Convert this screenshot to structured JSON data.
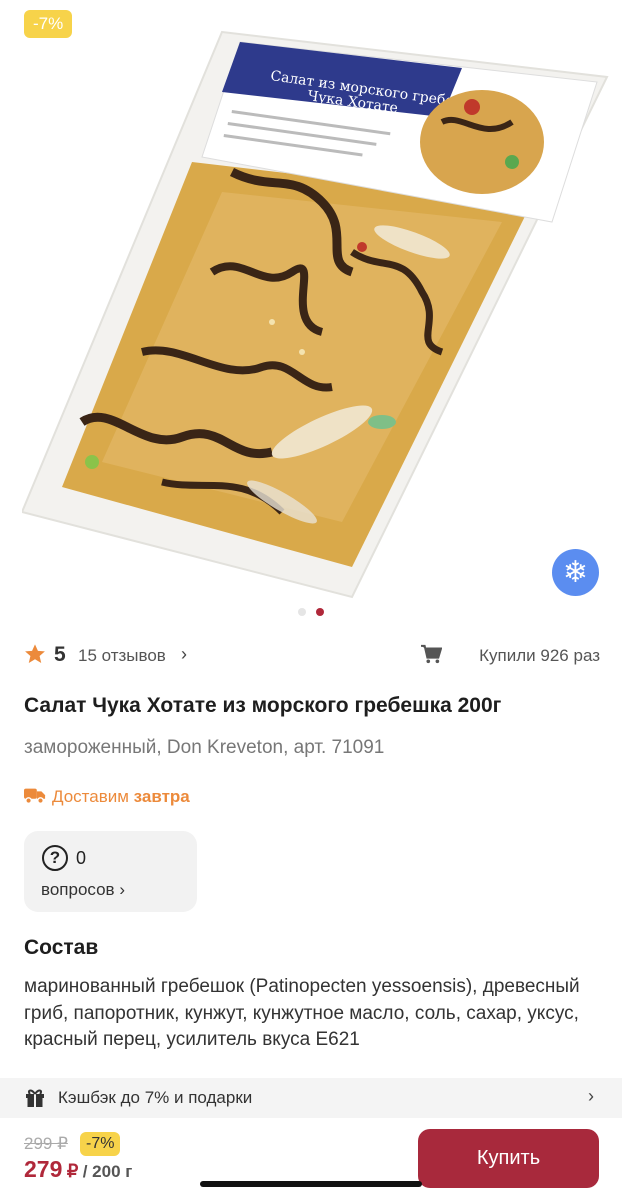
{
  "gallery": {
    "discount_badge": "-7%",
    "package_title_line1": "Салат из морского гребешка",
    "package_title_line2": "Чука Хотате",
    "slide_index": 2,
    "slide_count": 2
  },
  "rating": {
    "value": "5",
    "reviews": "15 отзывов",
    "bought": "Купили 926 раз"
  },
  "product": {
    "title": "Салат Чука Хотате из морского гребешка 200г",
    "subtitle": "замороженный, Don Kreveton, арт. 71091"
  },
  "delivery": {
    "prefix": "Доставим",
    "day": "завтра"
  },
  "questions": {
    "count": "0",
    "label": "вопросов"
  },
  "composition": {
    "title": "Состав",
    "text": "маринованный гребешок (Patinopecten yessoensis), древесный гриб, папоротник, кунжут, кунжутное масло, соль, сахар, уксус, красный перец, усилитель вкуса Е621"
  },
  "cashback": {
    "text": "Кэшбэк до 7% и подарки"
  },
  "buy": {
    "old_price": "299 ₽",
    "discount": "-7%",
    "price": "279",
    "currency": "₽",
    "unit": "/ 200 г",
    "button": "Купить"
  },
  "colors": {
    "accent": "#a8293c",
    "discount": "#f7d34a",
    "delivery": "#ec8a3b",
    "frozen_badge": "#5b8df0"
  }
}
